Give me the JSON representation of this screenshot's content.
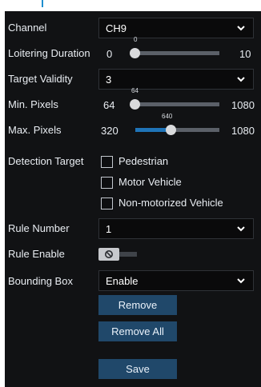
{
  "form": {
    "channel": {
      "label": "Channel",
      "value": "CH9"
    },
    "loitering_duration": {
      "label": "Loitering Duration",
      "min": "0",
      "max": "10",
      "current": "0",
      "level": 0.0
    },
    "target_validity": {
      "label": "Target Validity",
      "value": "3"
    },
    "min_pixels": {
      "label": "Min. Pixels",
      "min": "64",
      "max": "1080",
      "current": "64",
      "level": 0.0
    },
    "max_pixels": {
      "label": "Max. Pixels",
      "min": "320",
      "max": "1080",
      "current": "640",
      "level": 0.42
    },
    "detection_target": {
      "label": "Detection Target",
      "options": [
        {
          "label": "Pedestrian",
          "checked": false
        },
        {
          "label": "Motor Vehicle",
          "checked": false
        },
        {
          "label": "Non-motorized Vehicle",
          "checked": false
        }
      ]
    },
    "rule_number": {
      "label": "Rule Number",
      "value": "1"
    },
    "rule_enable": {
      "label": "Rule Enable",
      "enabled": false
    },
    "bounding_box": {
      "label": "Bounding Box",
      "value": "Enable"
    }
  },
  "buttons": {
    "remove": "Remove",
    "remove_all": "Remove All",
    "save": "Save"
  },
  "colors": {
    "panel": "#111214",
    "accent": "#1f74b8",
    "button": "#20486a"
  }
}
